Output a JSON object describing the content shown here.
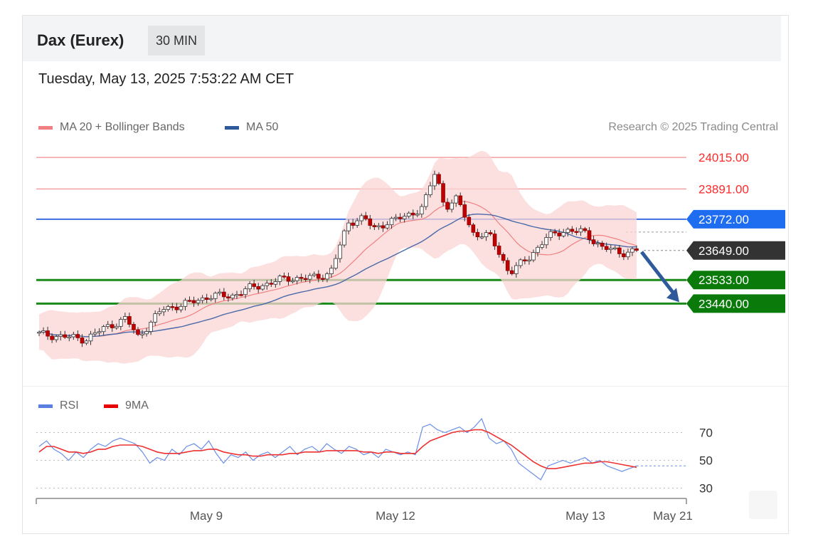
{
  "header": {
    "title": "Dax (Eurex)",
    "timeframe": "30 MIN"
  },
  "datetime": "Tuesday, May 13, 2025 7:53:22 AM CET",
  "legend": {
    "ma20": {
      "label": "MA 20 + Bollinger Bands",
      "color": "#f08080"
    },
    "ma50": {
      "label": "MA 50",
      "color": "#2e5a9c"
    }
  },
  "credit": "Research © 2025 Trading Central",
  "rsi_legend": {
    "rsi": {
      "label": "RSI",
      "color": "#5b7fe0"
    },
    "ma9": {
      "label": "9MA",
      "color": "#e60000"
    }
  },
  "chart_data": [
    {
      "type": "candlestick",
      "ylim": [
        23150,
        24060
      ],
      "levels": [
        {
          "value": 24015.0,
          "label": "24015.00",
          "kind": "resistance",
          "color": "#ff2a2a"
        },
        {
          "value": 23891.0,
          "label": "23891.00",
          "kind": "resistance",
          "color": "#ff2a2a"
        },
        {
          "value": 23772.0,
          "label": "23772.00",
          "kind": "pivot",
          "color": "#1e6cf0"
        },
        {
          "value": 23649.0,
          "label": "23649.00",
          "kind": "last-price",
          "color": "#333333"
        },
        {
          "value": 23533.0,
          "label": "23533.00",
          "kind": "support",
          "color": "#0a7a0a"
        },
        {
          "value": 23440.0,
          "label": "23440.00",
          "kind": "support",
          "color": "#0a7a0a"
        }
      ],
      "forecast": {
        "from": 23649,
        "to": 23440,
        "direction": "down"
      },
      "x_ticks": [
        "May 9",
        "May 12",
        "May 13",
        "May 21"
      ]
    },
    {
      "type": "line",
      "name": "RSI panel",
      "ylim": [
        20,
        80
      ],
      "y_ticks": [
        70,
        50,
        30
      ],
      "series": [
        {
          "name": "RSI",
          "values": [
            60,
            64,
            58,
            55,
            50,
            56,
            52,
            58,
            62,
            60,
            64,
            66,
            64,
            62,
            56,
            48,
            52,
            50,
            58,
            54,
            60,
            62,
            58,
            64,
            55,
            48,
            54,
            52,
            56,
            50,
            54,
            56,
            52,
            56,
            60,
            54,
            58,
            60,
            56,
            62,
            58,
            55,
            60,
            58,
            54,
            56,
            52,
            58,
            56,
            54,
            56,
            54,
            74,
            76,
            72,
            70,
            72,
            74,
            70,
            74,
            80,
            66,
            62,
            64,
            58,
            48,
            44,
            40,
            36,
            46,
            48,
            50,
            48,
            50,
            52,
            48,
            50,
            46,
            44,
            42,
            44,
            46
          ]
        },
        {
          "name": "9MA",
          "values": [
            56,
            60,
            60,
            58,
            56,
            56,
            55,
            56,
            58,
            58,
            60,
            61,
            61,
            61,
            60,
            58,
            56,
            55,
            55,
            55,
            56,
            57,
            57,
            58,
            58,
            56,
            55,
            54,
            54,
            53,
            53,
            54,
            54,
            54,
            55,
            55,
            56,
            56,
            56,
            57,
            57,
            57,
            57,
            57,
            56,
            56,
            55,
            56,
            56,
            55,
            55,
            55,
            60,
            64,
            66,
            68,
            70,
            71,
            71,
            72,
            72,
            70,
            67,
            64,
            61,
            57,
            53,
            49,
            46,
            44,
            44,
            45,
            46,
            47,
            48,
            48,
            49,
            49,
            48,
            47,
            46,
            45
          ]
        }
      ]
    }
  ]
}
